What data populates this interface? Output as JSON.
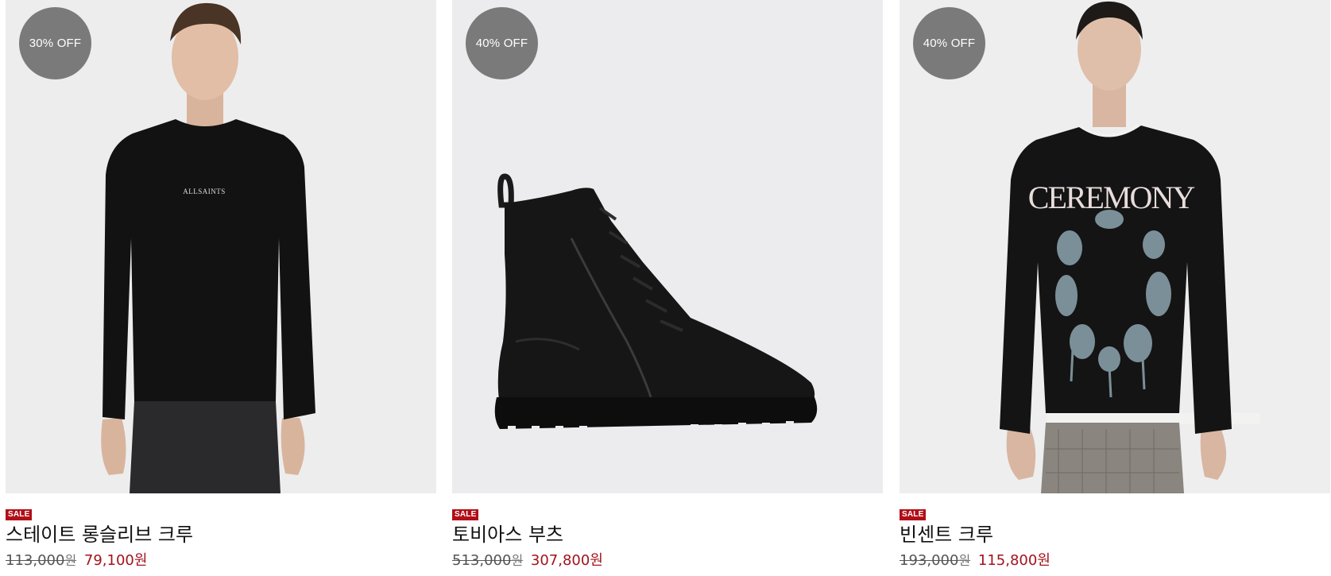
{
  "products": [
    {
      "badge": "30% OFF",
      "sale_tag": "SALE",
      "name": "스테이트 롱슬리브 크루",
      "original_price": "113,000",
      "original_unit": "원",
      "sale_price": "79,100원",
      "image_icon": "longsleeve-tshirt-model-image",
      "shirt_logo": "ALLSAINTS"
    },
    {
      "badge": "40% OFF",
      "sale_tag": "SALE",
      "name": "토비아스 부츠",
      "original_price": "513,000",
      "original_unit": "원",
      "sale_price": "307,800원",
      "image_icon": "leather-boot-image"
    },
    {
      "badge": "40% OFF",
      "sale_tag": "SALE",
      "name": "빈센트 크루",
      "original_price": "193,000",
      "original_unit": "원",
      "sale_price": "115,800원",
      "image_icon": "sweatshirt-model-image",
      "shirt_print": "CEREMONY"
    }
  ],
  "colors": {
    "badge_bg": "#7a7a7a",
    "sale_tag_bg": "#b10f18",
    "sale_price": "#a1141c",
    "image_bg": "#ececee"
  }
}
